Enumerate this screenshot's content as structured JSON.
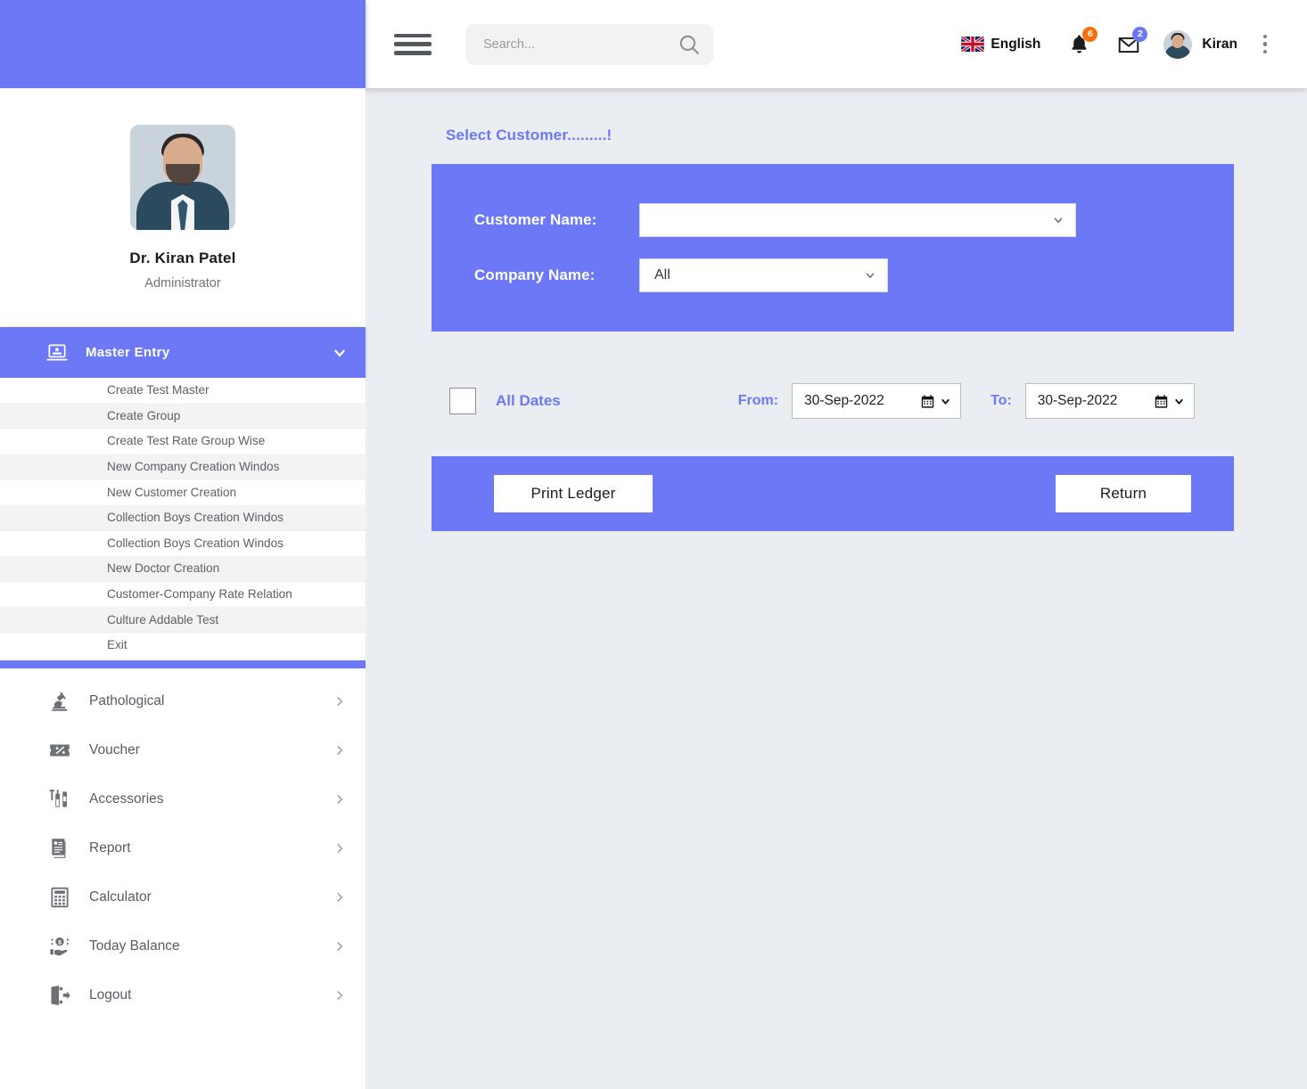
{
  "header": {
    "menu_icon": "hamburger-icon",
    "search": {
      "placeholder": "Search...",
      "value": "",
      "icon": "search-icon"
    },
    "language": {
      "label": "English",
      "flag": "uk-flag-icon"
    },
    "notifications": {
      "icon": "bell-icon",
      "count": "6",
      "badge_color": "#f5720b"
    },
    "messages": {
      "icon": "envelope-icon",
      "count": "2",
      "badge_color": "#6d78f6"
    },
    "user": {
      "name": "Kiran",
      "avatar": "user-avatar"
    },
    "more_icon": "vertical-dots-icon"
  },
  "sidebar": {
    "profile": {
      "name": "Dr. Kiran Patel",
      "role": "Administrator",
      "avatar": "profile-photo"
    },
    "active_group": {
      "label": "Master Entry",
      "icon": "computer-user-icon",
      "chevron": "chevron-down-icon",
      "items": [
        "Create Test Master",
        "Create Group",
        "Create Test Rate Group Wise",
        "New Company Creation Windos",
        "New Customer Creation",
        "Collection Boys Creation Windos",
        "Collection Boys Creation Windos",
        "New Doctor Creation",
        "Customer-Company Rate Relation",
        "Culture Addable Test",
        "Exit"
      ]
    },
    "nav": [
      {
        "label": "Pathological",
        "icon": "microscope-icon",
        "chevron": "chevron-right-icon"
      },
      {
        "label": "Voucher",
        "icon": "voucher-percent-icon",
        "chevron": "chevron-right-icon"
      },
      {
        "label": "Accessories",
        "icon": "test-tubes-icon",
        "chevron": "chevron-right-icon"
      },
      {
        "label": "Report",
        "icon": "document-report-icon",
        "chevron": "chevron-right-icon"
      },
      {
        "label": "Calculator",
        "icon": "calculator-icon",
        "chevron": "chevron-right-icon"
      },
      {
        "label": "Today Balance",
        "icon": "money-hand-icon",
        "chevron": "chevron-right-icon"
      },
      {
        "label": "Logout",
        "icon": "logout-door-icon",
        "chevron": "chevron-right-icon"
      }
    ]
  },
  "main": {
    "title": "Select Customer.........!",
    "form": {
      "customer_label": "Customer Name:",
      "customer_value": "",
      "company_label": "Company Name:",
      "company_value": "All"
    },
    "dates": {
      "all_dates_label": "All Dates",
      "all_dates_checked": false,
      "from_label": "From:",
      "from_value": "30-Sep-2022",
      "to_label": "To:",
      "to_value": "30-Sep-2022",
      "calendar_icon": "calendar-icon",
      "chevron": "chevron-down-icon"
    },
    "actions": {
      "print_label": "Print Ledger",
      "return_label": "Return"
    }
  },
  "colors": {
    "accent": "#6d78f6",
    "background": "#eaedf1",
    "badge_orange": "#f5720b"
  }
}
